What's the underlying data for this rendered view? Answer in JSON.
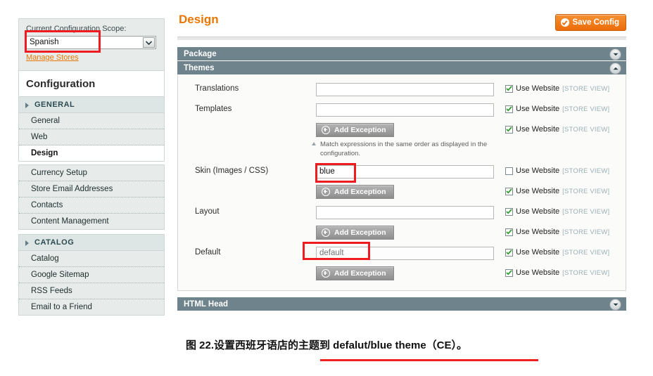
{
  "sidebar": {
    "scope": {
      "label": "Current Configuration Scope:",
      "value": "Spanish",
      "manage_link": "Manage Stores",
      "dropdown_icon": "chevron-down-icon"
    },
    "heading": "Configuration",
    "groups": [
      {
        "section": "GENERAL",
        "items": [
          {
            "label": "General",
            "active": false
          },
          {
            "label": "Web",
            "active": false
          },
          {
            "label": "Design",
            "active": true
          }
        ]
      },
      {
        "section": "",
        "items": [
          {
            "label": "Currency Setup",
            "active": false
          },
          {
            "label": "Store Email Addresses",
            "active": false
          },
          {
            "label": "Contacts",
            "active": false
          },
          {
            "label": "Content Management",
            "active": false
          }
        ]
      },
      {
        "section": "CATALOG",
        "items": [
          {
            "label": "Catalog",
            "active": false
          },
          {
            "label": "Google Sitemap",
            "active": false
          },
          {
            "label": "RSS Feeds",
            "active": false
          },
          {
            "label": "Email to a Friend",
            "active": false
          }
        ]
      }
    ]
  },
  "main": {
    "page_title": "Design",
    "save_button": {
      "label": "Save Config",
      "icon": "check-circle-icon",
      "color": "#ec6c09"
    },
    "sections": [
      {
        "title": "Package",
        "expanded": false,
        "toggle_icon": "chevron-down-icon"
      },
      {
        "title": "Themes",
        "expanded": true,
        "toggle_icon": "chevron-up-icon"
      },
      {
        "title": "HTML Head",
        "expanded": false,
        "toggle_icon": "chevron-down-icon"
      }
    ],
    "scope_suffix": "[STORE VIEW]",
    "use_website_label": "Use Website",
    "add_exception_label": "Add Exception",
    "hint_text": "Match expressions in the same order as displayed in the configuration.",
    "themes_rows": [
      {
        "label": "Translations",
        "value": "",
        "placeholder": "",
        "use_website": true
      },
      {
        "label": "Templates",
        "value": "",
        "placeholder": "",
        "use_website": true
      },
      {
        "label": "",
        "kind": "add-exception",
        "use_website": true,
        "has_hint": true
      },
      {
        "label": "Skin (Images / CSS)",
        "value": "blue",
        "placeholder": "",
        "use_website": false
      },
      {
        "label": "",
        "kind": "add-exception",
        "use_website": true
      },
      {
        "label": "Layout",
        "value": "",
        "placeholder": "",
        "use_website": true
      },
      {
        "label": "",
        "kind": "add-exception",
        "use_website": true
      },
      {
        "label": "Default",
        "value": "",
        "placeholder": "default",
        "use_website": true
      },
      {
        "label": "",
        "kind": "add-exception",
        "use_website": true
      }
    ]
  },
  "caption": {
    "text": "图 22.设置西班牙语店的主题到 defalut/blue theme（CE）。",
    "underline_color": "#ee2222"
  },
  "annotations": {
    "highlight_color": "#ee1c21",
    "boxes": [
      "scope-select-highlight",
      "skin-field-highlight",
      "default-field-highlight"
    ]
  }
}
